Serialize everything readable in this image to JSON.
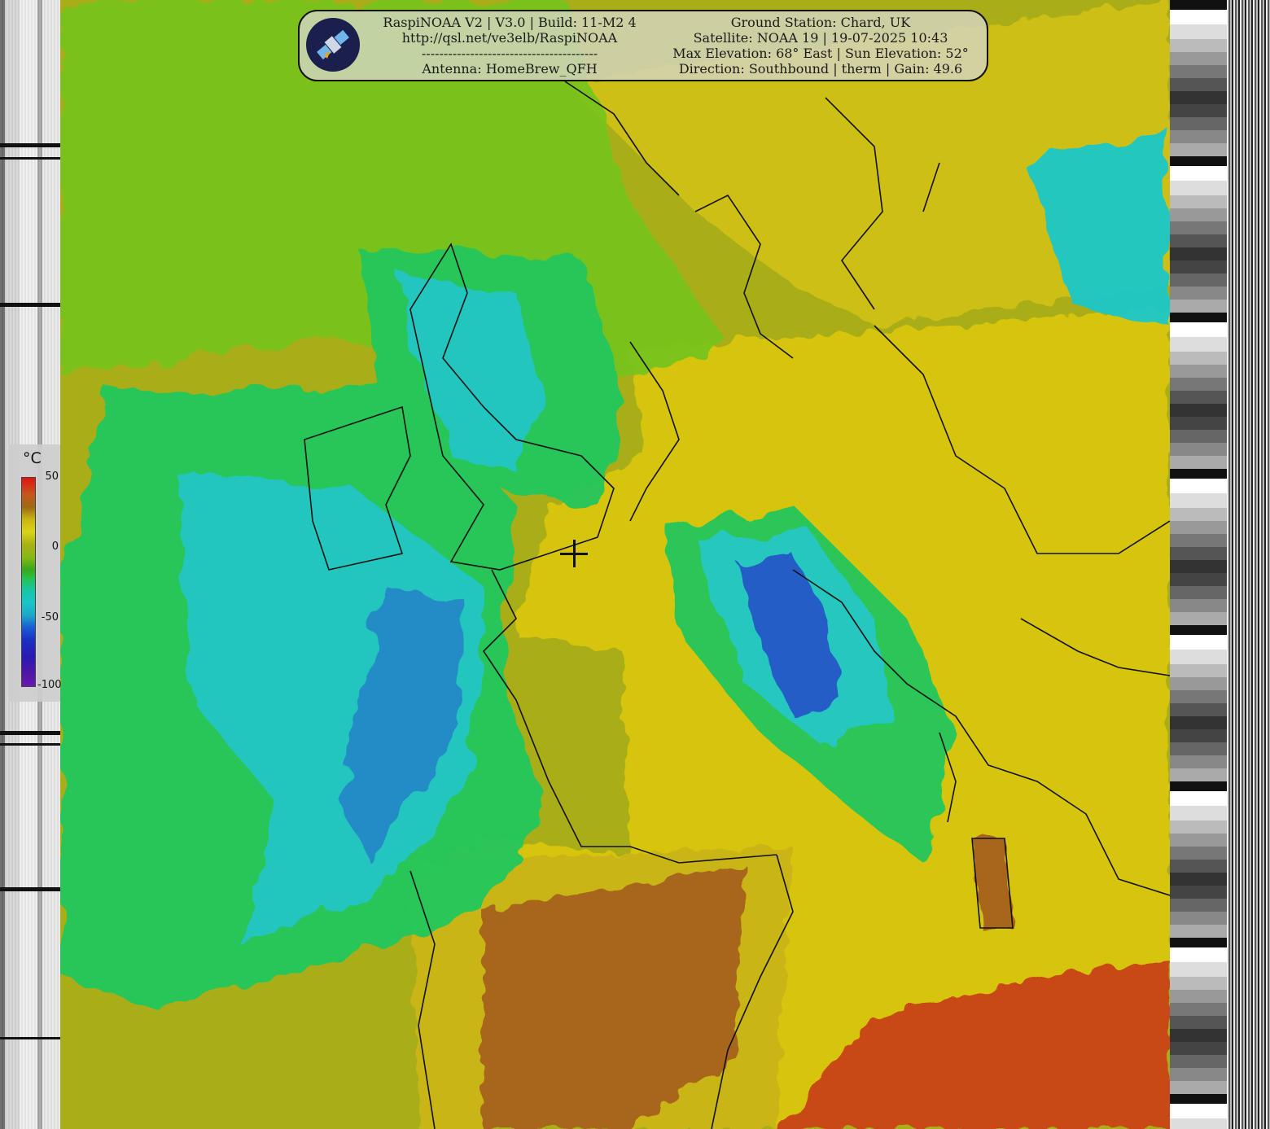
{
  "header": {
    "left_lines": [
      "RaspiNOAA V2 | V3.0 | Build: 11-M2 4",
      "http://qsl.net/ve3elb/RaspiNOAA",
      "----------------------------------------",
      "Antenna: HomeBrew_QFH"
    ],
    "right_lines": [
      "Ground Station: Chard, UK",
      "Satellite: NOAA 19 | 19-07-2025 10:43",
      "Max Elevation: 68° East | Sun Elevation: 52°",
      "Direction: Southbound | therm | Gain: 49.6"
    ],
    "logo_icon": "satellite-icon"
  },
  "legend": {
    "unit": "°C",
    "ticks": [
      "50",
      "0",
      "-50",
      "-100"
    ],
    "colors": {
      "hot": "#e3120f",
      "warm": "#9c6a14",
      "mild": "#d9d417",
      "cool": "#3aa818",
      "cold": "#19c6c6",
      "very_cold": "#1a5ad6",
      "coldest": "#6a18b0"
    }
  },
  "map": {
    "marker_icon": "crosshair-icon",
    "palette": {
      "land_hot": "#a8661a",
      "land_warm": "#d6c40f",
      "sea": "#a9ad18",
      "cloud_low": "#78c41c",
      "cloud_mid": "#22c75c",
      "cloud_high": "#1ec8c8",
      "cloud_top": "#1a58d2",
      "desert": "#c84012",
      "coast": "#111111"
    }
  }
}
